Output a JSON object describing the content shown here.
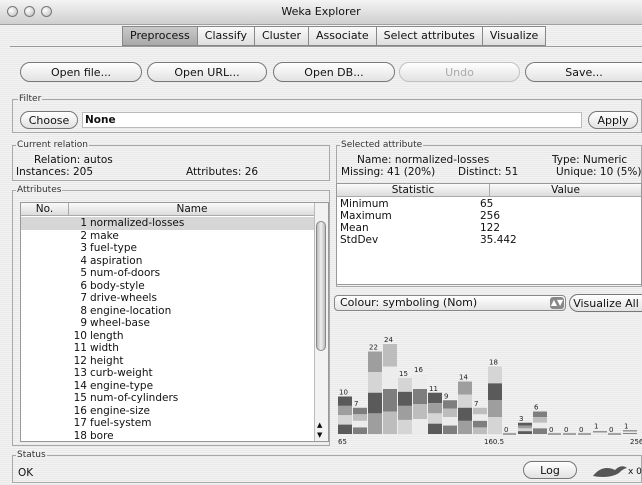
{
  "window": {
    "title": "Weka Explorer"
  },
  "tabs": [
    {
      "label": "Preprocess",
      "active": true
    },
    {
      "label": "Classify",
      "active": false
    },
    {
      "label": "Cluster",
      "active": false
    },
    {
      "label": "Associate",
      "active": false
    },
    {
      "label": "Select attributes",
      "active": false
    },
    {
      "label": "Visualize",
      "active": false
    }
  ],
  "toolbar": {
    "open_file": "Open file...",
    "open_url": "Open URL...",
    "open_db": "Open DB...",
    "undo": "Undo",
    "save": "Save..."
  },
  "filter": {
    "group_label": "Filter",
    "choose": "Choose",
    "value": "None",
    "apply": "Apply"
  },
  "relation": {
    "group_label": "Current relation",
    "relation": "Relation: autos",
    "instances": "Instances: 205",
    "attributes": "Attributes: 26"
  },
  "attributes": {
    "group_label": "Attributes",
    "col_no": "No.",
    "col_name": "Name",
    "rows": [
      {
        "no": "1",
        "name": "normalized-losses"
      },
      {
        "no": "2",
        "name": "make"
      },
      {
        "no": "3",
        "name": "fuel-type"
      },
      {
        "no": "4",
        "name": "aspiration"
      },
      {
        "no": "5",
        "name": "num-of-doors"
      },
      {
        "no": "6",
        "name": "body-style"
      },
      {
        "no": "7",
        "name": "drive-wheels"
      },
      {
        "no": "8",
        "name": "engine-location"
      },
      {
        "no": "9",
        "name": "wheel-base"
      },
      {
        "no": "10",
        "name": "length"
      },
      {
        "no": "11",
        "name": "width"
      },
      {
        "no": "12",
        "name": "height"
      },
      {
        "no": "13",
        "name": "curb-weight"
      },
      {
        "no": "14",
        "name": "engine-type"
      },
      {
        "no": "15",
        "name": "num-of-cylinders"
      },
      {
        "no": "16",
        "name": "engine-size"
      },
      {
        "no": "17",
        "name": "fuel-system"
      },
      {
        "no": "18",
        "name": "bore"
      }
    ]
  },
  "selected_attribute": {
    "group_label": "Selected attribute",
    "name": "Name: normalized-losses",
    "type": "Type: Numeric",
    "missing": "Missing: 41 (20%)",
    "distinct": "Distinct: 51",
    "unique": "Unique: 10 (5%)",
    "col_statistic": "Statistic",
    "col_value": "Value",
    "stats": [
      {
        "label": "Minimum",
        "value": "65"
      },
      {
        "label": "Maximum",
        "value": "256"
      },
      {
        "label": "Mean",
        "value": "122"
      },
      {
        "label": "StdDev",
        "value": "35.442"
      }
    ]
  },
  "colour": {
    "label": "Colour: symboling (Nom)",
    "visualize_all": "Visualize All"
  },
  "histogram": {
    "x_min_label": "65",
    "x_mid_label": "160.5",
    "x_max_label": "256",
    "counts": [
      10,
      7,
      22,
      24,
      15,
      16,
      11,
      9,
      14,
      7,
      18,
      0,
      3,
      6,
      0,
      0,
      0,
      1,
      0,
      1
    ],
    "palette": [
      "#5a5a5a",
      "#7e7e7e",
      "#9e9e9e",
      "#bdbdbd",
      "#d5d5d5",
      "#ececec"
    ]
  },
  "status": {
    "group_label": "Status",
    "text": "OK",
    "log": "Log",
    "x_count": "x 0"
  }
}
